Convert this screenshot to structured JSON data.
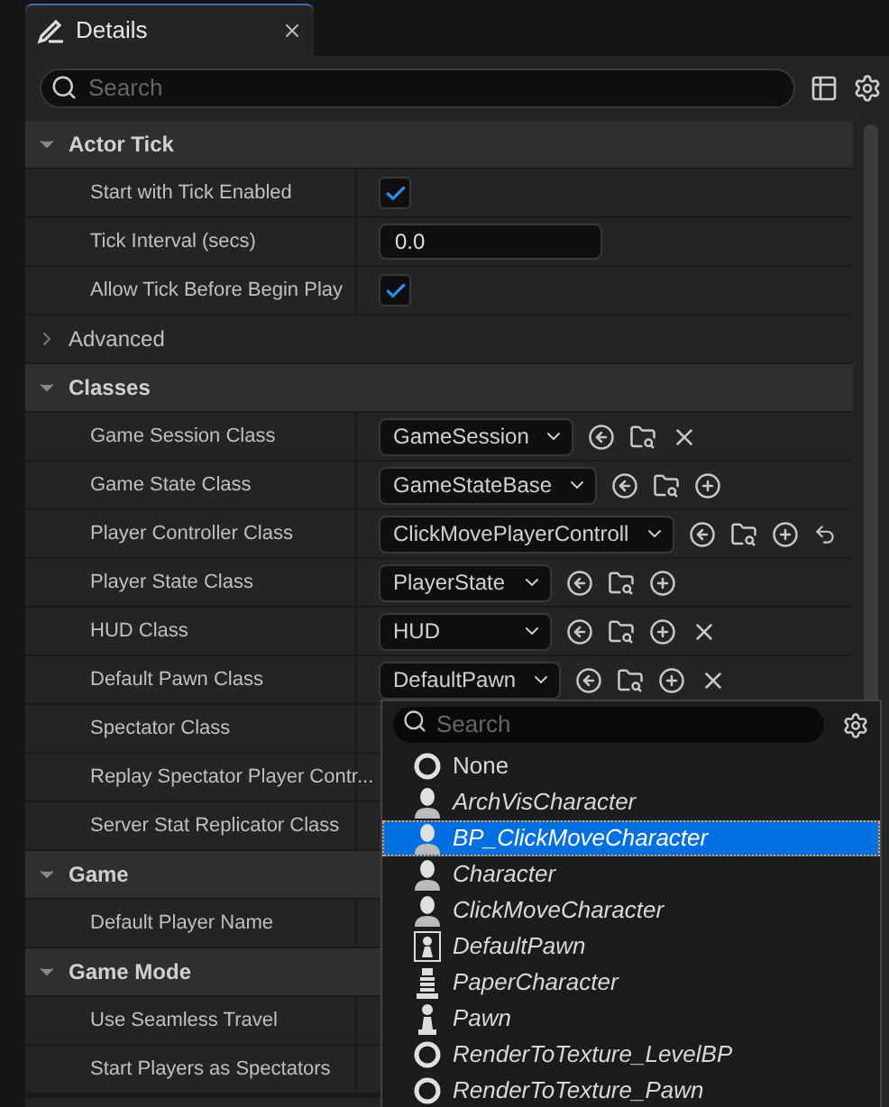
{
  "tab": {
    "title": "Details"
  },
  "search": {
    "placeholder": "Search"
  },
  "sections": [
    {
      "title": "Actor Tick",
      "expanded": true,
      "rows": [
        {
          "kind": "checkbox",
          "label": "Start with Tick Enabled",
          "checked": true
        },
        {
          "kind": "number",
          "label": "Tick Interval (secs)",
          "value": "0.0"
        },
        {
          "kind": "checkbox",
          "label": "Allow Tick Before Begin Play",
          "checked": true
        },
        {
          "kind": "group",
          "label": "Advanced",
          "expanded": false
        }
      ]
    },
    {
      "title": "Classes",
      "expanded": true,
      "rows": [
        {
          "kind": "class",
          "label": "Game Session Class",
          "value": "GameSession",
          "buttons": [
            {
              "kind": "use"
            },
            {
              "kind": "browse"
            },
            {
              "kind": "clear"
            }
          ]
        },
        {
          "kind": "class",
          "label": "Game State Class",
          "value": "GameStateBase",
          "buttons": [
            {
              "kind": "use"
            },
            {
              "kind": "browse"
            },
            {
              "kind": "add"
            }
          ]
        },
        {
          "kind": "class",
          "label": "Player Controller Class",
          "value": "ClickMovePlayerControll",
          "buttons": [
            {
              "kind": "use"
            },
            {
              "kind": "browse"
            },
            {
              "kind": "add"
            },
            {
              "kind": "reset"
            }
          ]
        },
        {
          "kind": "class",
          "label": "Player State Class",
          "value": "PlayerState",
          "buttons": [
            {
              "kind": "use"
            },
            {
              "kind": "browse"
            },
            {
              "kind": "add"
            }
          ]
        },
        {
          "kind": "class",
          "label": "HUD Class",
          "value": "HUD",
          "buttons": [
            {
              "kind": "use"
            },
            {
              "kind": "browse"
            },
            {
              "kind": "add"
            },
            {
              "kind": "clear"
            }
          ]
        },
        {
          "kind": "class",
          "label": "Default Pawn Class",
          "value": "DefaultPawn",
          "buttons": [
            {
              "kind": "use"
            },
            {
              "kind": "browse"
            },
            {
              "kind": "add"
            },
            {
              "kind": "clear"
            }
          ]
        },
        {
          "kind": "empty",
          "label": "Spectator Class"
        },
        {
          "kind": "empty",
          "label": "Replay Spectator Player Contr..."
        },
        {
          "kind": "empty",
          "label": "Server Stat Replicator Class"
        }
      ]
    },
    {
      "title": "Game",
      "expanded": true,
      "rows": [
        {
          "kind": "empty",
          "label": "Default Player Name"
        }
      ]
    },
    {
      "title": "Game Mode",
      "expanded": true,
      "rows": [
        {
          "kind": "empty",
          "label": "Use Seamless Travel"
        },
        {
          "kind": "empty",
          "label": "Start Players as Spectators"
        }
      ]
    }
  ],
  "picker": {
    "search": {
      "placeholder": "Search"
    },
    "items": [
      {
        "kind": "none",
        "label": "None",
        "selected": false
      },
      {
        "kind": "character",
        "label": "ArchVisCharacter",
        "selected": false
      },
      {
        "kind": "character",
        "label": "BP_ClickMoveCharacter",
        "selected": true
      },
      {
        "kind": "character",
        "label": "Character",
        "selected": false
      },
      {
        "kind": "character",
        "label": "ClickMoveCharacter",
        "selected": false
      },
      {
        "kind": "pawnbox",
        "label": "DefaultPawn",
        "selected": false
      },
      {
        "kind": "paper",
        "label": "PaperCharacter",
        "selected": false
      },
      {
        "kind": "pawn",
        "label": "Pawn",
        "selected": false
      },
      {
        "kind": "none",
        "label": "RenderToTexture_LevelBP",
        "selected": false
      },
      {
        "kind": "none",
        "label": "RenderToTexture_Pawn",
        "selected": false
      }
    ]
  }
}
